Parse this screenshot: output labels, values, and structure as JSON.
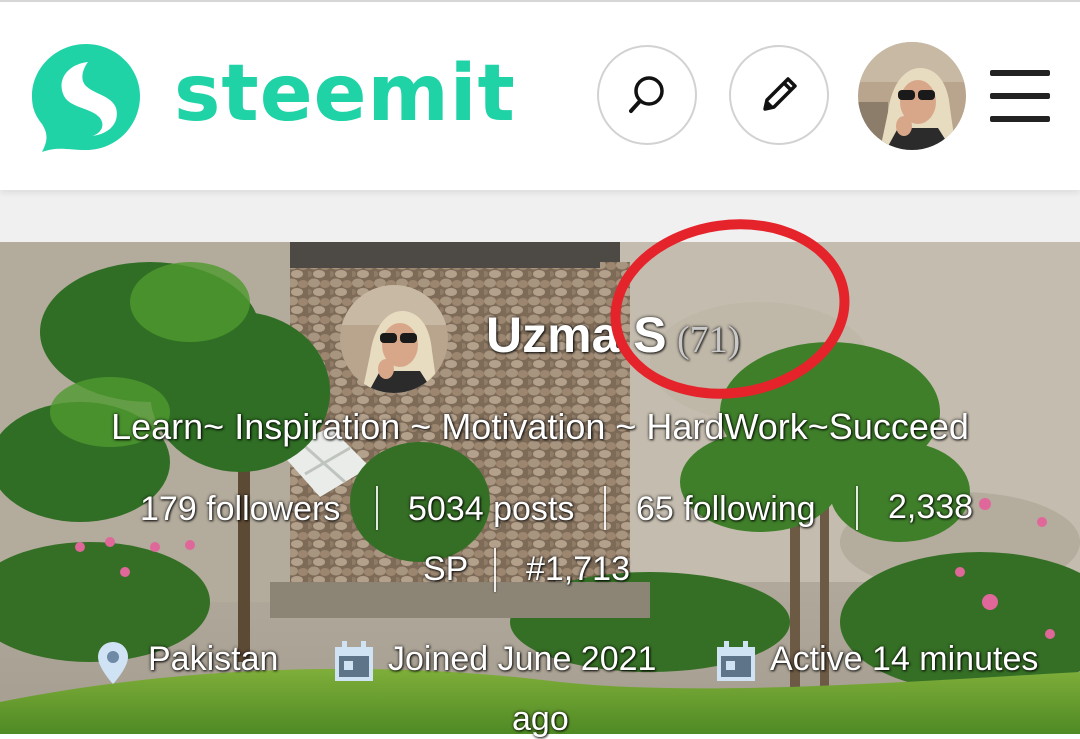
{
  "header": {
    "brand_name": "steemit",
    "brand_color": "#1fd3a7",
    "icons": {
      "logo": "steemit-logo-icon",
      "search": "search-icon",
      "edit": "pencil-icon",
      "menu": "hamburger-menu-icon"
    }
  },
  "profile": {
    "display_name": "Uzma S",
    "reputation": "(71)",
    "about": "Learn~ Inspiration ~ Motivation ~ HardWork~Succeed",
    "stats": {
      "followers": "179 followers",
      "posts": "5034 posts",
      "following": "65 following",
      "sp_value": "2,338",
      "sp_unit": "SP",
      "rank": "#1,713"
    },
    "meta": {
      "location": "Pakistan",
      "joined": "Joined June 2021",
      "active": "Active 14 minutes",
      "active_suffix": "ago"
    }
  },
  "colors": {
    "annotation_circle": "#e5232b"
  }
}
